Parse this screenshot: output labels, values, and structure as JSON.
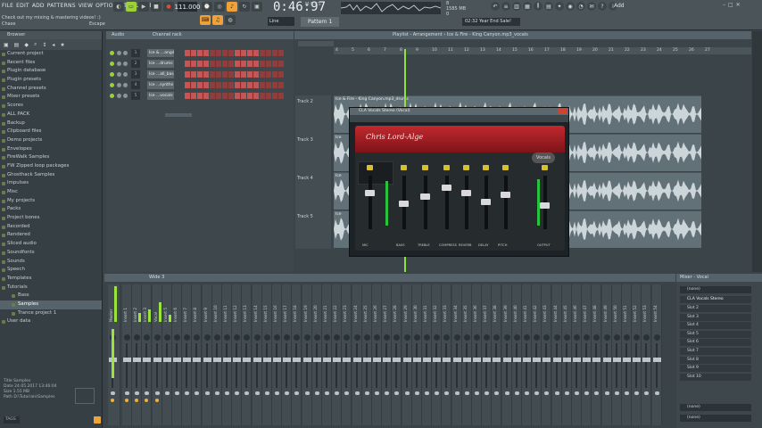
{
  "menu": [
    "FILE",
    "EDIT",
    "ADD",
    "PATTERNS",
    "VIEW",
    "OPTIONS",
    "TOOLS",
    "HELP"
  ],
  "hint": {
    "line1": "Check out my mixing & mastering videos! :)",
    "line2": "Chase",
    "tag": "Escape"
  },
  "tempo": "111.000",
  "clock": "0:46:97",
  "clock_sub": "M:S:CS",
  "cpu": {
    "line1": "8",
    "line2": "1585 MB",
    "line3": "0"
  },
  "news": "02:32 Year End Sale!",
  "pattern": "Pattern 1",
  "snap": "Line",
  "add_label": "Add",
  "browser": {
    "title": "Browser",
    "items": [
      {
        "label": "Current project",
        "sub": false,
        "sel": false
      },
      {
        "label": "Recent files",
        "sub": false,
        "sel": false
      },
      {
        "label": "Plugin database",
        "sub": false,
        "sel": false
      },
      {
        "label": "Plugin presets",
        "sub": false,
        "sel": false
      },
      {
        "label": "Channel presets",
        "sub": false,
        "sel": false
      },
      {
        "label": "Mixer presets",
        "sub": false,
        "sel": false
      },
      {
        "label": "Scores",
        "sub": false,
        "sel": false
      },
      {
        "label": "ALL PACK",
        "sub": false,
        "sel": false
      },
      {
        "label": "Backup",
        "sub": false,
        "sel": false
      },
      {
        "label": "Clipboard files",
        "sub": false,
        "sel": false
      },
      {
        "label": "Demo projects",
        "sub": false,
        "sel": false
      },
      {
        "label": "Envelopes",
        "sub": false,
        "sel": false
      },
      {
        "label": "FireWalk Samples",
        "sub": false,
        "sel": false
      },
      {
        "label": "FW Zipped loop packages",
        "sub": false,
        "sel": false
      },
      {
        "label": "Ghosthack Samples",
        "sub": false,
        "sel": false
      },
      {
        "label": "Impulses",
        "sub": false,
        "sel": false
      },
      {
        "label": "Misc",
        "sub": false,
        "sel": false
      },
      {
        "label": "My projects",
        "sub": false,
        "sel": false
      },
      {
        "label": "Packs",
        "sub": false,
        "sel": false
      },
      {
        "label": "Project bones",
        "sub": false,
        "sel": false
      },
      {
        "label": "Recorded",
        "sub": false,
        "sel": false
      },
      {
        "label": "Rendered",
        "sub": false,
        "sel": false
      },
      {
        "label": "Sliced audio",
        "sub": false,
        "sel": false
      },
      {
        "label": "Soundfonts",
        "sub": false,
        "sel": false
      },
      {
        "label": "Sounds",
        "sub": false,
        "sel": false
      },
      {
        "label": "Speech",
        "sub": false,
        "sel": false
      },
      {
        "label": "Templates",
        "sub": false,
        "sel": false
      },
      {
        "label": "Tutorials",
        "sub": false,
        "sel": false
      },
      {
        "label": "Bass",
        "sub": true,
        "sel": false
      },
      {
        "label": "Samples",
        "sub": true,
        "sel": true
      },
      {
        "label": "Trance project 1",
        "sub": true,
        "sel": false
      },
      {
        "label": "User data",
        "sub": false,
        "sel": false
      }
    ],
    "info": {
      "title": "Title  Samples",
      "date": "Date  24.05.2017 13:46:04",
      "size": "Size  1.55 MB",
      "path": "Path  D:\\Tutorials\\Samples"
    },
    "search": "TAGS"
  },
  "rack": {
    "title": "Channel rack",
    "filter": "Audio",
    "channels": [
      {
        "num": "1",
        "name": "Ice & ...angdr"
      },
      {
        "num": "2",
        "name": "Ice ...drums"
      },
      {
        "num": "3",
        "name": "Ice ...all_bass"
      },
      {
        "num": "4",
        "name": "Ice ...synths"
      },
      {
        "num": "5",
        "name": "Ice ...vocals"
      }
    ]
  },
  "playlist": {
    "title": "Playlist - Arrangement › Ice & Fire - King Canyon.mp3_vocals",
    "tracks": [
      {
        "name": "Track 2",
        "clip": "Ice & Fire - King Canyon.mp3_drums"
      },
      {
        "name": "Track 3",
        "clip": "Ice"
      },
      {
        "name": "Track 4",
        "clip": "Ice"
      },
      {
        "name": "Track 5",
        "clip": "Ice"
      }
    ],
    "ruler": [
      "4",
      "5",
      "6",
      "7",
      "8",
      "9",
      "10",
      "11",
      "12",
      "13",
      "14",
      "15",
      "16",
      "17",
      "18",
      "19",
      "20",
      "21",
      "22",
      "23",
      "24",
      "25",
      "26",
      "27"
    ]
  },
  "plugin": {
    "title": "CLA Vocals Stereo (Vocal)",
    "face": "Chris Lord-Alge",
    "tag": "Vocals",
    "labels": [
      "MIC",
      "BASS",
      "TREBLE",
      "COMPRESS",
      "REVERB",
      "DELAY",
      "PITCH",
      "OUTPUT"
    ]
  },
  "mixer": {
    "title": "Mixer - Vocal",
    "header": "Wide 3",
    "rslot_top": "(none)",
    "rslot_first": "CLA Vocals Stereo",
    "slots": [
      "Slot 2",
      "Slot 3",
      "Slot 4",
      "Slot 5",
      "Slot 6",
      "Slot 7",
      "Slot 8",
      "Slot 9",
      "Slot 10"
    ],
    "bottom": [
      "(none)",
      "(none)"
    ],
    "strips": [
      "Master",
      "Insert 1",
      "Insert 2",
      "Insert 3",
      "Vocal",
      "Insert 5",
      "Insert 6",
      "Insert 7",
      "Insert 8",
      "Insert 9",
      "Insert 10",
      "Insert 11",
      "Insert 12",
      "Insert 13",
      "Insert 14",
      "Insert 15",
      "Insert 16",
      "Insert 17",
      "Insert 18",
      "Insert 19",
      "Insert 20",
      "Insert 21",
      "Insert 22",
      "Insert 23",
      "Insert 24",
      "Insert 25",
      "Insert 26",
      "Insert 27",
      "Insert 28",
      "Insert 29",
      "Insert 30",
      "Insert 31",
      "Insert 32",
      "Insert 33",
      "Insert 34",
      "Insert 35",
      "Insert 36",
      "Insert 37",
      "Insert 38",
      "Insert 39",
      "Insert 40",
      "Insert 41",
      "Insert 42",
      "Insert 43",
      "Insert 44",
      "Insert 45",
      "Insert 46",
      "Insert 47",
      "Insert 48",
      "Insert 49",
      "Insert 50",
      "Insert 51",
      "Insert 52",
      "Insert 53",
      "Insert 54"
    ]
  },
  "colors": {
    "accent_green": "#9ad333",
    "accent_orange": "#f0a23a",
    "plugin_red": "#c1292e"
  }
}
